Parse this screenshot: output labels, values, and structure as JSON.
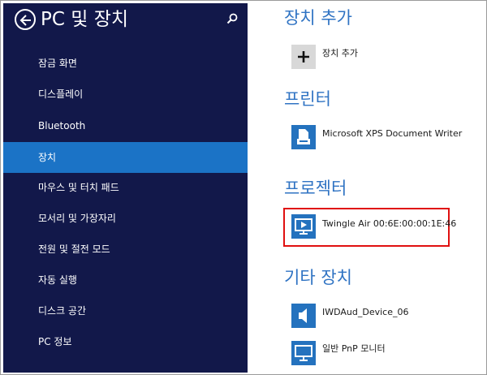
{
  "sidebar": {
    "title": "PC 및 장치",
    "items": [
      {
        "label": "잠금 화면"
      },
      {
        "label": "디스플레이"
      },
      {
        "label": "Bluetooth"
      },
      {
        "label": "장치"
      },
      {
        "label": "마우스 및 터치 패드"
      },
      {
        "label": "모서리 및 가장자리"
      },
      {
        "label": "전원 및 절전 모드"
      },
      {
        "label": "자동 실행"
      },
      {
        "label": "디스크 공간"
      },
      {
        "label": "PC 정보"
      }
    ],
    "selected_index": 3
  },
  "main": {
    "sections": [
      {
        "heading": "장치 추가",
        "devices": [
          {
            "name": "장치 추가",
            "icon": "plus-icon"
          }
        ]
      },
      {
        "heading": "프린터",
        "devices": [
          {
            "name": "Microsoft XPS Document Writer",
            "icon": "printer-icon"
          }
        ]
      },
      {
        "heading": "프로젝터",
        "devices": [
          {
            "name": "Twingle Air 00:6E:00:00:1E:46",
            "icon": "projector-icon"
          }
        ]
      },
      {
        "heading": "기타 장치",
        "devices": [
          {
            "name": "IWDAud_Device_06",
            "icon": "speaker-icon"
          },
          {
            "name": "일반 PnP 모니터",
            "icon": "monitor-icon"
          }
        ]
      }
    ]
  },
  "colors": {
    "sidebar_bg": "#12184a",
    "selected_bg": "#1b73c6",
    "heading": "#2f73c3",
    "tile_blue": "#2472be",
    "highlight": "#e01010"
  }
}
